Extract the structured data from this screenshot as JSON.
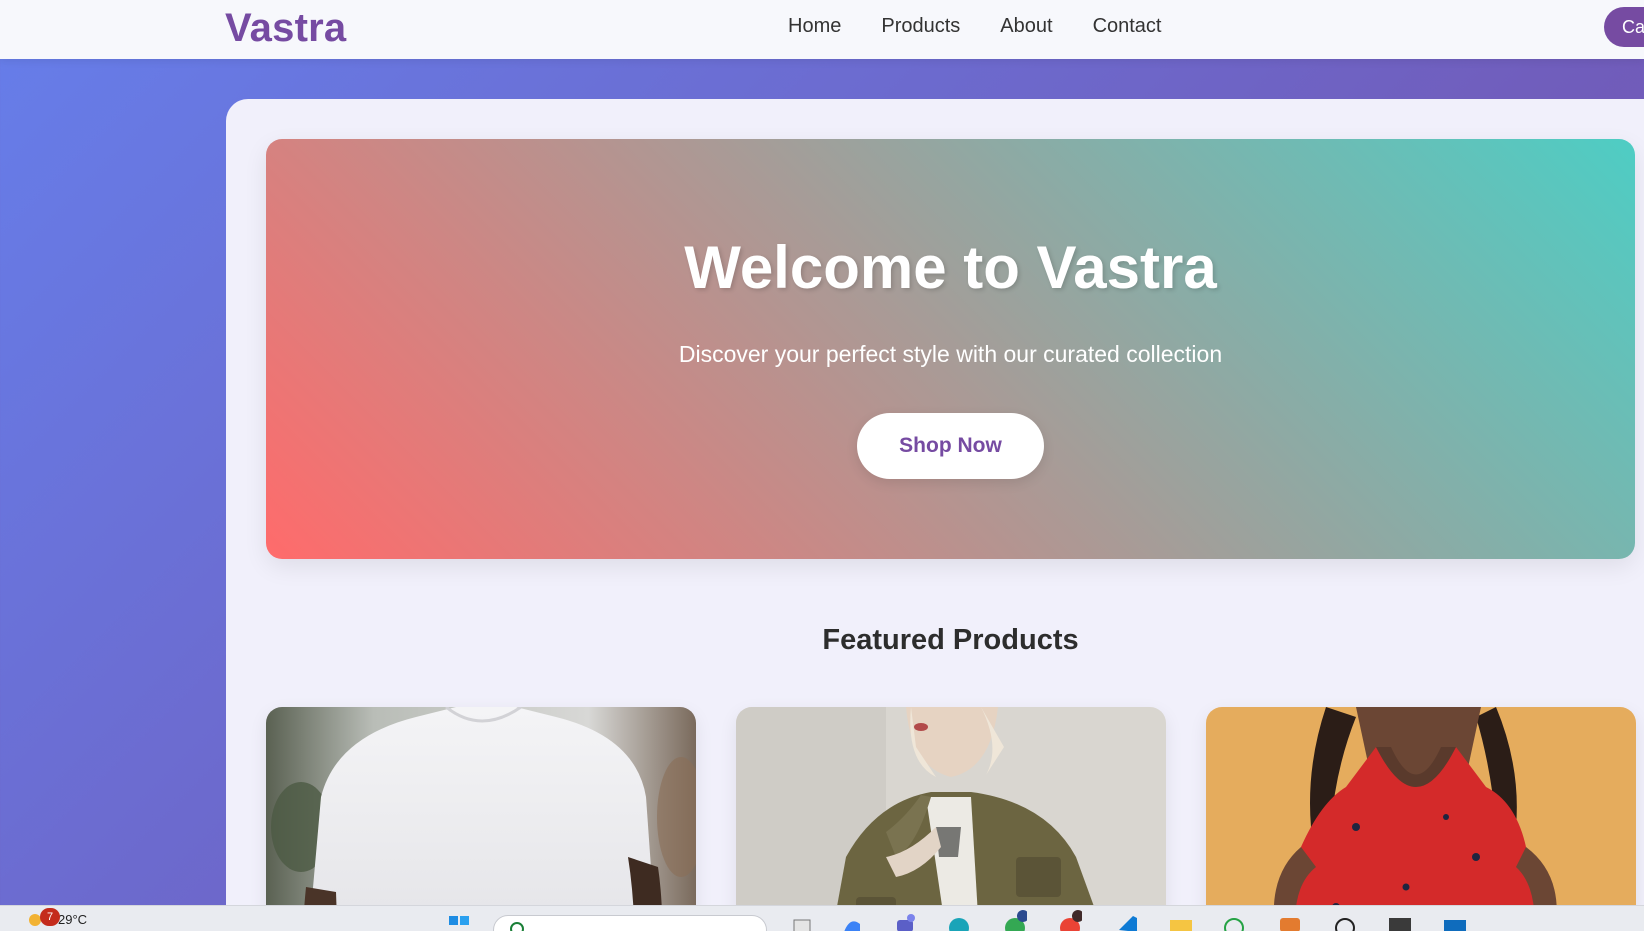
{
  "navbar": {
    "logo": "Vastra",
    "links": [
      "Home",
      "Products",
      "About",
      "Contact"
    ],
    "cart_label": "Ca"
  },
  "hero": {
    "title": "Welcome to Vastra",
    "subtitle": "Discover your perfect style with our curated collection",
    "cta_label": "Shop Now"
  },
  "featured": {
    "title": "Featured Products",
    "products": [
      {
        "image": "white-tshirt-photo"
      },
      {
        "image": "olive-jacket-photo"
      },
      {
        "image": "red-floral-dress-photo"
      }
    ]
  },
  "taskbar": {
    "weather_temp": "29°C",
    "weather_badge": "7"
  },
  "colors": {
    "brand": "#764ba2",
    "hero_start": "#ff6b6b",
    "hero_end": "#4ecdc4"
  }
}
